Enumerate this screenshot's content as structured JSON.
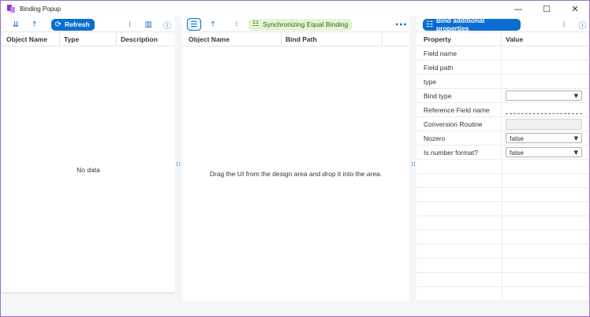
{
  "window": {
    "title": "Binding Popup",
    "controls": {
      "minimize": "—",
      "maximize": "☐",
      "close": "✕"
    }
  },
  "left_panel": {
    "toolbar": {
      "sort_icon": "sort-descending-icon",
      "collapse_icon": "collapse-up-icon",
      "refresh_label": "Refresh",
      "refresh_icon": "refresh-icon",
      "columns_icon": "column-settings-icon",
      "table_icon": "table-view-icon",
      "help_icon": "help-icon"
    },
    "columns": [
      "Object Name",
      "Type",
      "Description"
    ],
    "empty_text": "No data"
  },
  "middle_panel": {
    "toolbar": {
      "list_icon": "list-view-icon",
      "collapse_icon": "collapse-up-icon",
      "tree_icon": "tree-icon",
      "sync_label": "Synchronizing Equal Binding",
      "more_label": "•••"
    },
    "columns": [
      "Object Name",
      "Bind Path"
    ],
    "empty_text": "Drag the UI from the design area and drop it into the area."
  },
  "right_panel": {
    "toolbar": {
      "bind_label": "Bind additional properties",
      "columns_icon": "column-settings-icon",
      "help_icon": "help-icon"
    },
    "columns": [
      "Property",
      "Value"
    ],
    "rows": [
      {
        "name": "Field name",
        "kind": "text",
        "value": ""
      },
      {
        "name": "Field path",
        "kind": "text",
        "value": ""
      },
      {
        "name": "type",
        "kind": "text",
        "value": ""
      },
      {
        "name": "Bind type",
        "kind": "select",
        "value": ""
      },
      {
        "name": "Reference Field name",
        "kind": "dashed",
        "value": ""
      },
      {
        "name": "Conversion Routine",
        "kind": "input",
        "value": ""
      },
      {
        "name": "Nozero",
        "kind": "select",
        "value": "false"
      },
      {
        "name": "Is number format?",
        "kind": "select",
        "value": "false"
      }
    ]
  },
  "colors": {
    "accent": "#0a6ed1",
    "window_border": "#a070c0",
    "sync_bg": "#e5f3d6",
    "sync_text": "#2b6a12"
  }
}
